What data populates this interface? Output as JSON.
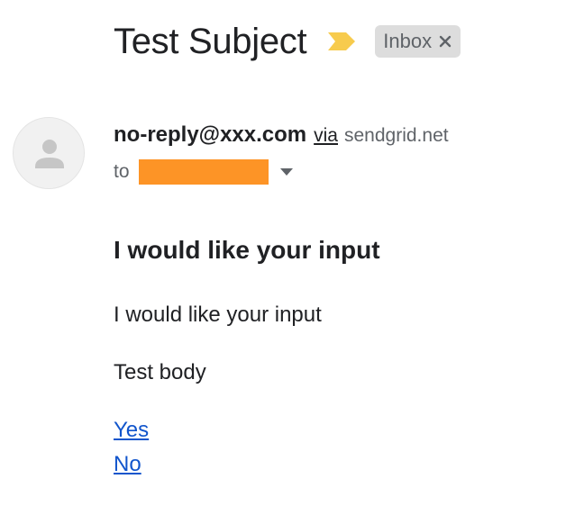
{
  "email": {
    "subject": "Test Subject",
    "label": "Inbox",
    "sender_email": "no-reply@xxx.com",
    "via_label": "via",
    "via_domain": "sendgrid.net",
    "to_label": "to",
    "body_heading": "I would like your input",
    "body_paragraphs": [
      "I would like your input",
      "Test body"
    ],
    "links": [
      "Yes",
      "No"
    ]
  },
  "icons": {
    "importance": "importance-marker-icon",
    "label_remove": "close-icon",
    "avatar": "default-avatar-icon",
    "details": "caret-down-icon"
  },
  "colors": {
    "importance": "#f7cb4d",
    "chip_bg": "#dddddd",
    "redaction": "#fd9426",
    "link": "#1155cc"
  }
}
